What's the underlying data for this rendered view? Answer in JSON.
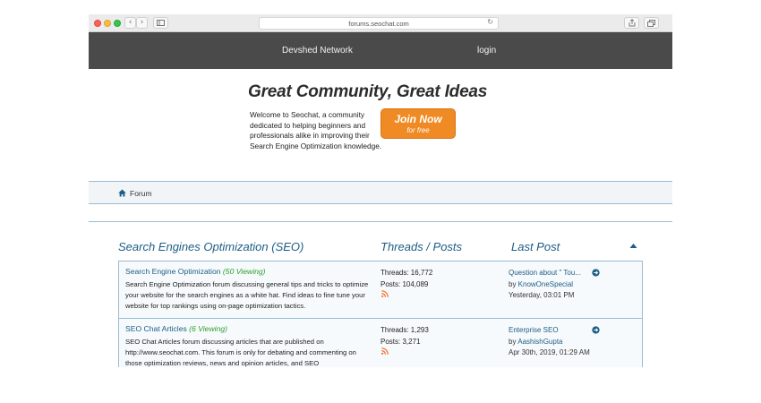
{
  "browser": {
    "address": "forums.seochat.com"
  },
  "nav": {
    "brand": "Devshed Network",
    "login": "login"
  },
  "hero": {
    "title": "Great Community, Great Ideas",
    "description": "Welcome to Seochat, a community dedicated to helping beginners and professionals alike in improving their Search Engine Optimization knowledge.",
    "join_main": "Join Now",
    "join_sub": "for free"
  },
  "breadcrumb": {
    "label": "Forum"
  },
  "section": {
    "title": "Search Engines Optimization (SEO)",
    "threads_posts": "Threads / Posts",
    "last_post": "Last Post"
  },
  "forums": [
    {
      "name": "Search Engine Optimization",
      "viewing": "(50 Viewing)",
      "description": "Search Engine Optimization forum discussing general tips and tricks to optimize your website for the search engines as a white hat. Find ideas to fine tune your website for top rankings using on-page optimization tactics.",
      "threads": "Threads: 16,772",
      "posts": "Posts: 104,089",
      "last_post_title": "Question about \" Tou...",
      "last_post_by_prefix": "by ",
      "last_post_author": "KnowOneSpecial",
      "last_post_time": "Yesterday, 03:01 PM"
    },
    {
      "name": "SEO Chat Articles",
      "viewing": "(6 Viewing)",
      "description": "SEO Chat Articles forum discussing articles that are published on http://www.seochat.com. This forum is only for debating and commenting on those optimization reviews, news and opinion articles, and SEO",
      "threads": "Threads: 1,293",
      "posts": "Posts: 3,271",
      "last_post_title": "Enterprise SEO",
      "last_post_by_prefix": "by ",
      "last_post_author": "AashishGupta",
      "last_post_time": "Apr 30th, 2019, 01:29 AM"
    }
  ],
  "colors": {
    "nav_bg": "#4a4a4a",
    "accent_blue": "#1c5d86",
    "join_orange": "#f08a24",
    "viewing_green": "#2a9f2a",
    "rss_orange": "#f26f21"
  }
}
